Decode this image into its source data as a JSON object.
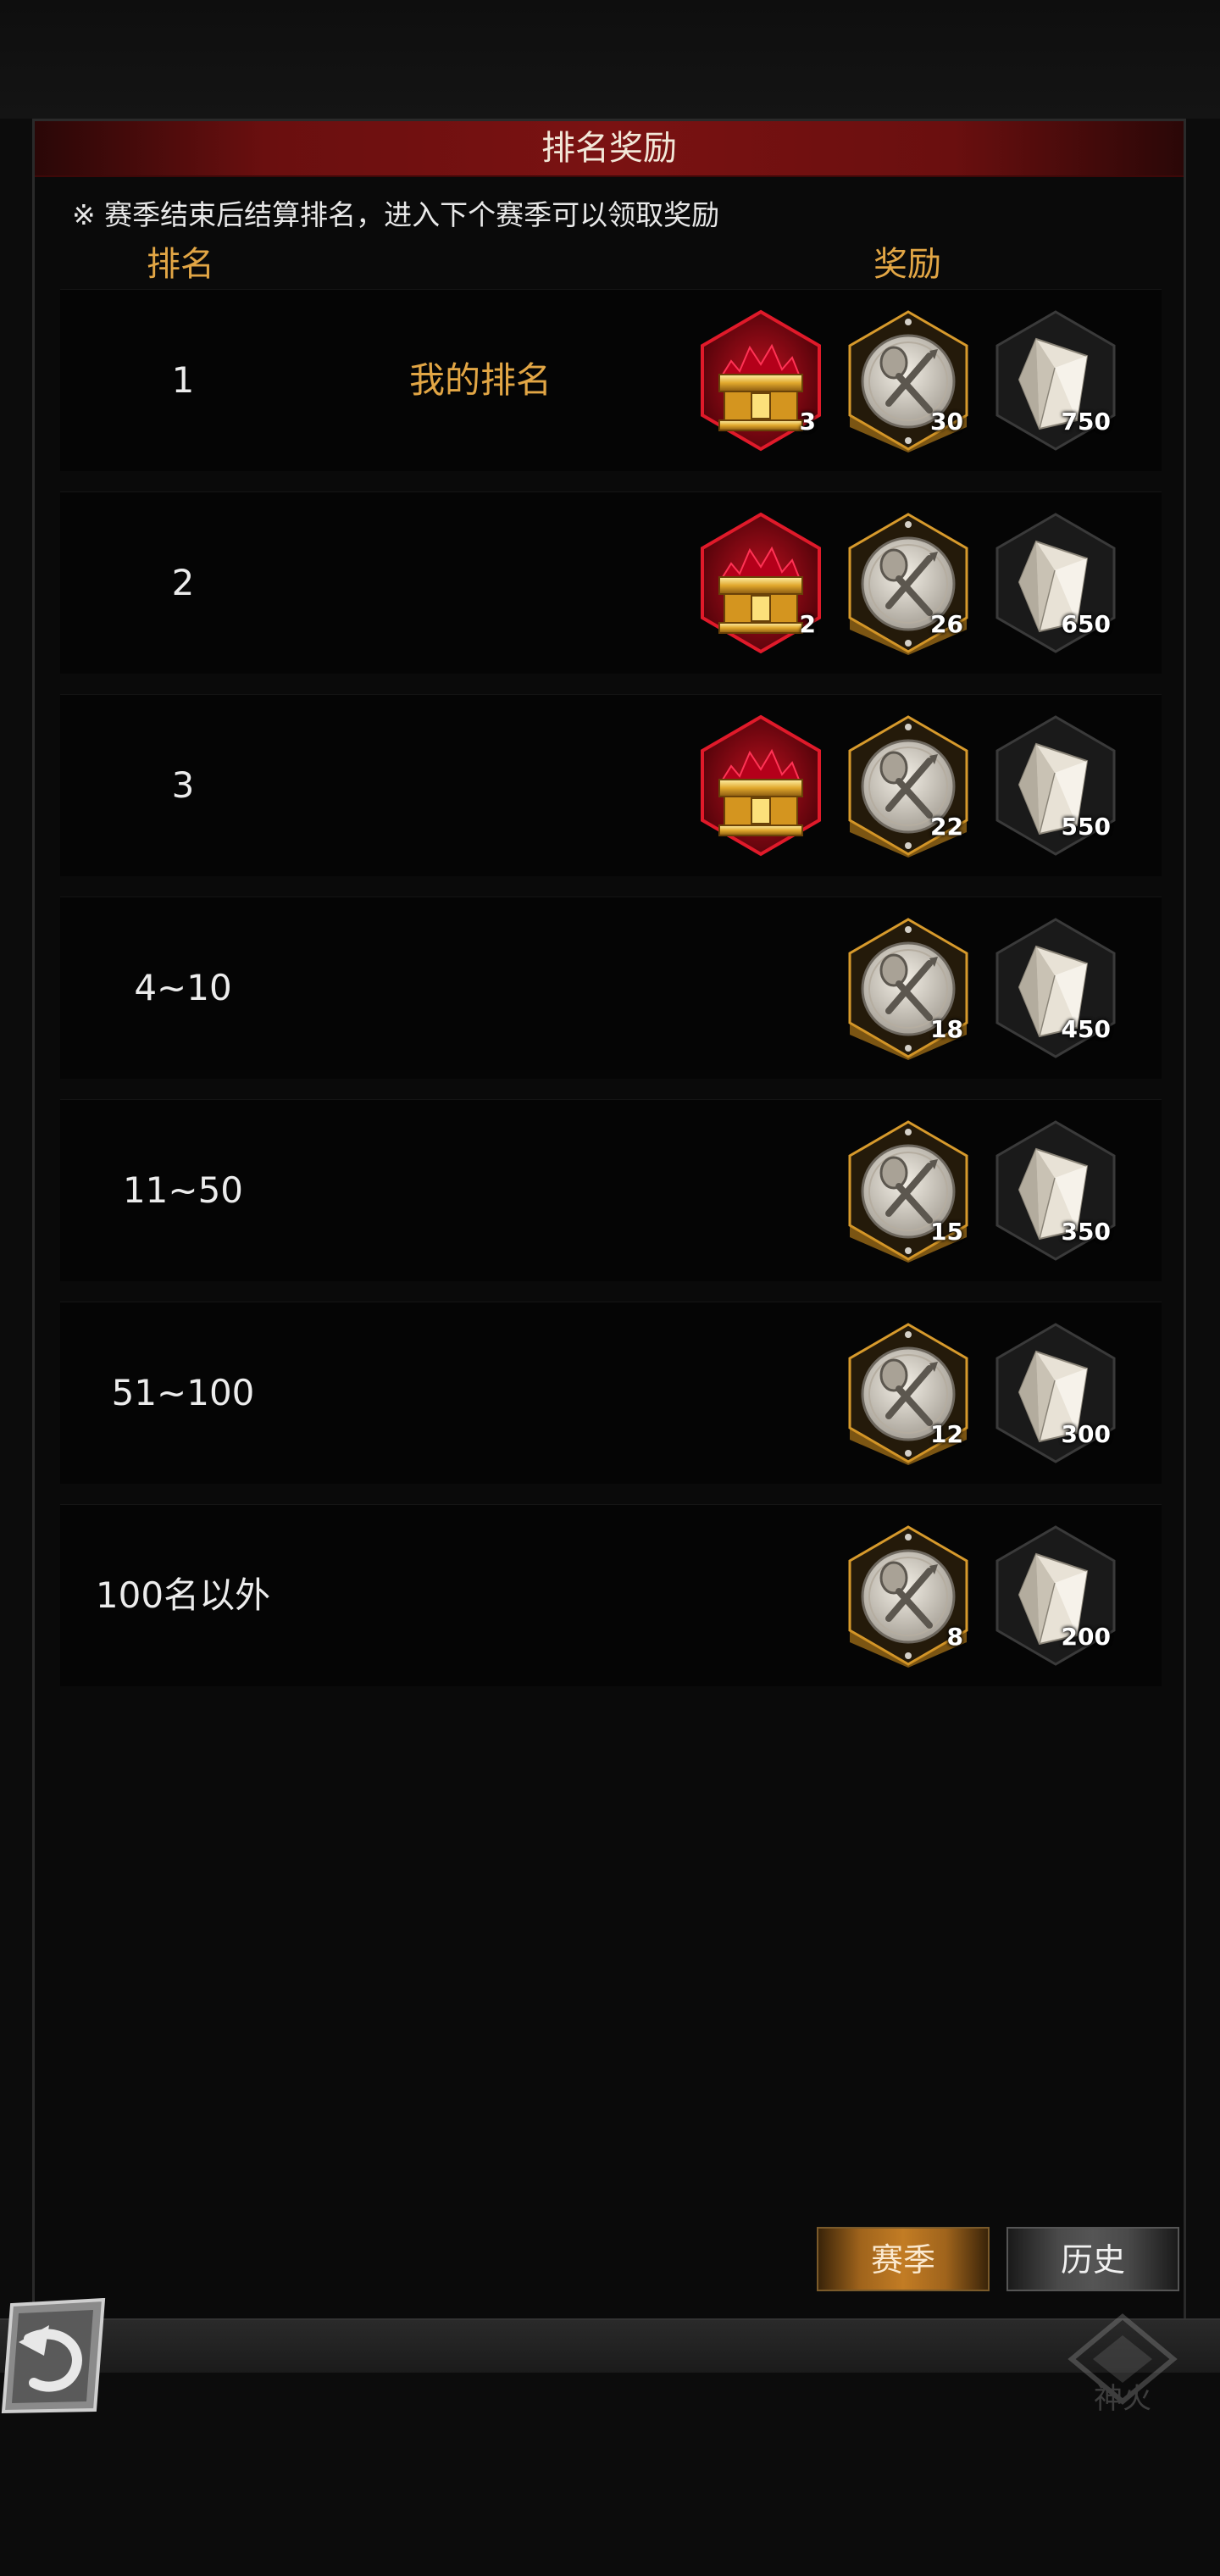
{
  "header": {
    "title": "排名奖励"
  },
  "notice": "※ 赛季结束后结算排名，进入下个赛季可以领取奖励",
  "columns": {
    "rank": "排名",
    "reward": "奖励"
  },
  "my_rank_label": "我的排名",
  "rows": [
    {
      "rank": "1",
      "chest": "3",
      "token": "30",
      "crystal": "750"
    },
    {
      "rank": "2",
      "chest": "2",
      "token": "26",
      "crystal": "650"
    },
    {
      "rank": "3",
      "chest": null,
      "token": "22",
      "crystal": "550"
    },
    {
      "rank": "4~10",
      "token": "18",
      "crystal": "450"
    },
    {
      "rank": "11~50",
      "token": "15",
      "crystal": "350"
    },
    {
      "rank": "51~100",
      "token": "12",
      "crystal": "300"
    },
    {
      "rank": "100名以外",
      "token": "8",
      "crystal": "200"
    }
  ],
  "icons": {
    "chest": "red-gold-chest-icon",
    "token": "crossed-swords-token-icon",
    "crystal": "crystal-icon",
    "back": "back-arrow-icon"
  },
  "tabs": {
    "season": "赛季",
    "history": "历史"
  },
  "logo_text": "神火",
  "colors": {
    "title_bar": "#7a1212",
    "gold_text": "#e2a645",
    "season_tab": "#c27c24",
    "chest_red": "#c0101f"
  }
}
